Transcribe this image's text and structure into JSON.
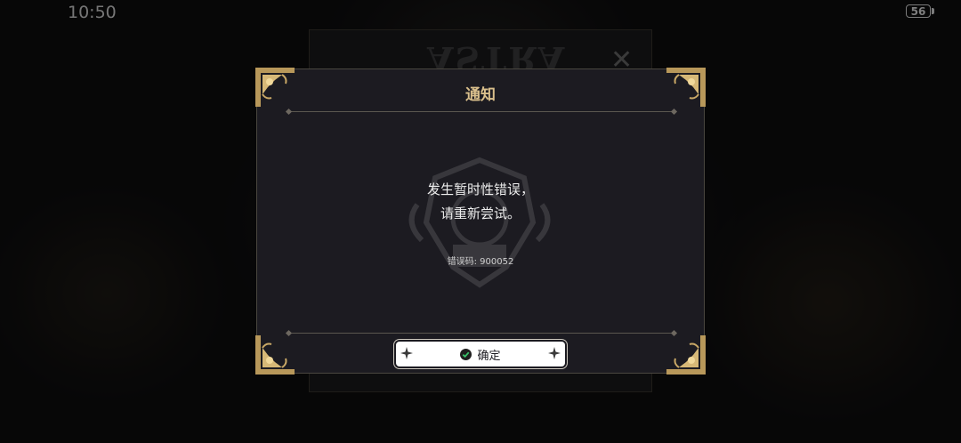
{
  "status_bar": {
    "time": "10:50",
    "battery": "56"
  },
  "background": {
    "logo_text": "ASTRA"
  },
  "dialog": {
    "title": "通知",
    "message_line1": "发生暂时性错误，",
    "message_line2": "请重新尝试。",
    "error_code": "错误码: 900052",
    "confirm_label": "确定"
  },
  "colors": {
    "title_gold": "#d9bf8c",
    "panel_bg": "#1c1b21",
    "button_bg": "#ffffff"
  },
  "icons": [
    "corner-ornament-icon",
    "check-icon",
    "sparkle-icon",
    "close-icon",
    "battery-icon"
  ]
}
